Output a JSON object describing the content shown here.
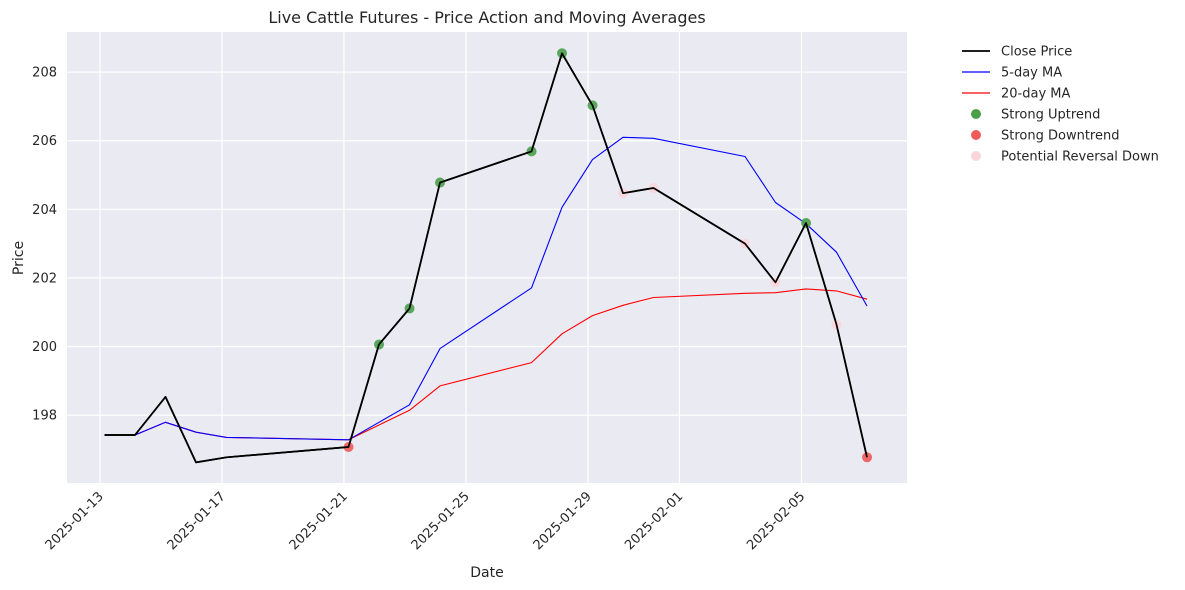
{
  "chart_data": {
    "type": "line",
    "title": "Live Cattle Futures - Price Action and Moving Averages",
    "xlabel": "Date",
    "ylabel": "Price",
    "ylim": [
      196.02,
      209.17
    ],
    "xlim_days_from_2025-01-13": [
      -1.08,
      26.46
    ],
    "grid": true,
    "legend_position": "outside-top-right",
    "x_tick_labels": [
      "2025-01-13",
      "2025-01-17",
      "2025-01-21",
      "2025-01-25",
      "2025-01-29",
      "2025-02-01",
      "2025-02-05"
    ],
    "x_tick_days": [
      0,
      4,
      8,
      12,
      16,
      19,
      23
    ],
    "y_ticks": [
      198,
      200,
      202,
      204,
      206,
      208
    ],
    "x": [
      "2025-01-13",
      "2025-01-14",
      "2025-01-15",
      "2025-01-16",
      "2025-01-17",
      "2025-01-21",
      "2025-01-22",
      "2025-01-23",
      "2025-01-24",
      "2025-01-27",
      "2025-01-28",
      "2025-01-29",
      "2025-01-30",
      "2025-01-31",
      "2025-02-03",
      "2025-02-04",
      "2025-02-05",
      "2025-02-06",
      "2025-02-07"
    ],
    "series": [
      {
        "name": "Close Price",
        "kind": "line",
        "color": "#000000",
        "values": [
          197.42,
          197.42,
          198.53,
          196.62,
          196.77,
          197.07,
          200.06,
          201.11,
          204.78,
          205.69,
          208.55,
          207.03,
          204.47,
          204.62,
          203.0,
          201.87,
          203.6,
          200.64,
          196.77
        ]
      },
      {
        "name": "5-day MA",
        "kind": "line",
        "color": "#0000ff",
        "values": [
          197.42,
          197.42,
          197.79,
          197.5,
          197.35,
          197.28,
          197.79,
          198.3,
          199.94,
          201.71,
          204.06,
          205.45,
          206.1,
          206.07,
          205.54,
          204.2,
          203.58,
          202.75,
          201.18
        ]
      },
      {
        "name": "20-day MA",
        "kind": "line",
        "color": "#ff0000",
        "values": [
          197.42,
          197.42,
          197.79,
          197.5,
          197.35,
          197.28,
          197.71,
          198.14,
          198.85,
          199.53,
          200.37,
          200.9,
          201.2,
          201.43,
          201.55,
          201.57,
          201.68,
          201.62,
          201.38
        ]
      },
      {
        "name": "Strong Uptrend",
        "kind": "scatter",
        "color": "#4a9e4a",
        "points": [
          [
            "2025-01-22",
            200.06
          ],
          [
            "2025-01-23",
            201.11
          ],
          [
            "2025-01-24",
            204.78
          ],
          [
            "2025-01-27",
            205.69
          ],
          [
            "2025-01-28",
            208.55
          ],
          [
            "2025-01-29",
            207.03
          ],
          [
            "2025-02-05",
            203.6
          ]
        ]
      },
      {
        "name": "Strong Downtrend",
        "kind": "scatter",
        "color": "#f05a5a",
        "points": [
          [
            "2025-01-21",
            197.07
          ],
          [
            "2025-02-07",
            196.77
          ]
        ]
      },
      {
        "name": "Potential Reversal Down",
        "kind": "scatter",
        "color": "#f9d5dc",
        "points": [
          [
            "2025-01-30",
            204.47
          ],
          [
            "2025-01-31",
            204.62
          ],
          [
            "2025-02-03",
            203.0
          ],
          [
            "2025-02-04",
            201.87
          ],
          [
            "2025-02-06",
            200.64
          ]
        ]
      }
    ]
  }
}
